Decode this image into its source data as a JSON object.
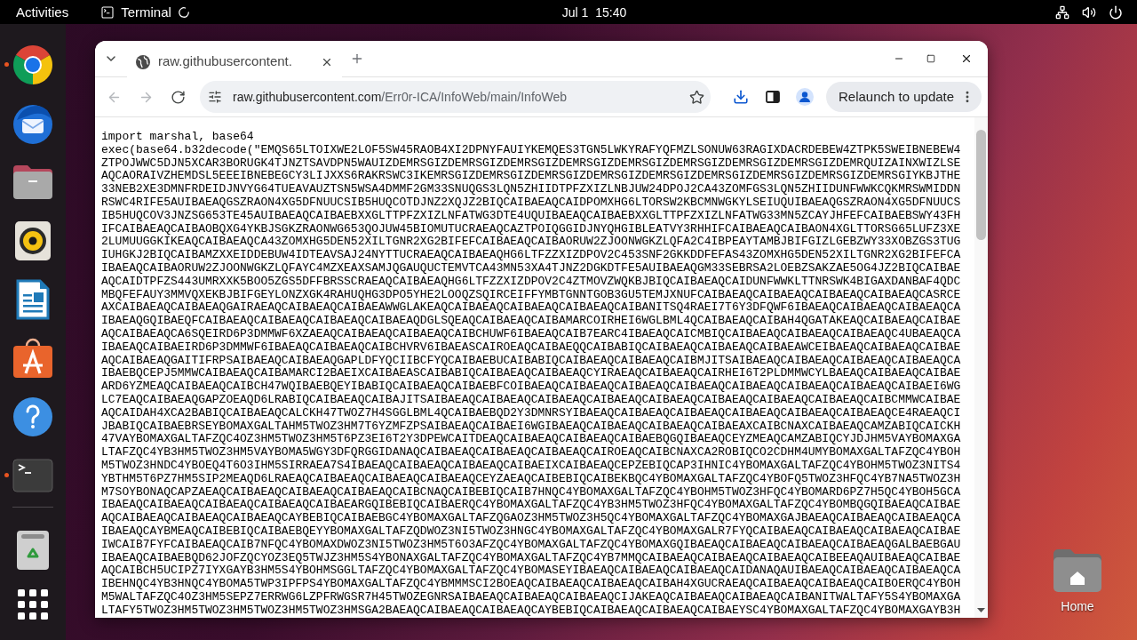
{
  "top_bar": {
    "activities": "Activities",
    "app": {
      "name": "Terminal",
      "loading": true
    },
    "clock": "Jul 1  15:40"
  },
  "dock": {
    "items": [
      {
        "kind": "browser",
        "running": true
      },
      {
        "kind": "mail",
        "running": false
      },
      {
        "kind": "files",
        "running": false
      },
      {
        "kind": "music",
        "running": false
      },
      {
        "kind": "writer",
        "running": false
      },
      {
        "kind": "store",
        "running": false
      },
      {
        "kind": "help",
        "running": false
      },
      {
        "kind": "terminal",
        "running": true
      }
    ],
    "extras": [
      {
        "kind": "trash"
      },
      {
        "kind": "apps"
      }
    ]
  },
  "browser": {
    "tabs": [
      {
        "title": "raw.githubusercontent.",
        "selected": true
      }
    ],
    "nav": [
      {
        "kind": "back",
        "disabled": true
      },
      {
        "kind": "forward",
        "disabled": true
      },
      {
        "kind": "reload",
        "disabled": false
      }
    ],
    "address": {
      "host": "raw.githubusercontent.com",
      "path": "/Err0r-ICA/InfoWeb/main/InfoWeb"
    },
    "relaunch": "Relaunch to update",
    "page_lines": [
      "import marshal, base64",
      "exec(base64.b32decode(\"EMQS65LTOIXWE2LOF5SW45RAOB4XI2DPNYFAUIYKEMQES3TGN5LWKYRAFYQFMZLSONUW63RAGIXDACRDEBEW4ZTPK5SWEIBNEBEW4",
      "ZTPOJWWC5DJN5XCAR3BORUGK4TJNZTSAVDPN5WAUIZDEMRSGIZDEMRSGIZDEMRSGIZDEMRSGIZDEMRSGIZDEMRSGIZDEMRSGIZDEMRSGIZDEMRQUIZAINXWIZLSE",
      "AQCAORAIVZHEMDSL5EEEIBNEBEGCY3LIJXXS6RAKRSWC3IKEMRSGIZDEMRSGIZDEMRSGIZDEMRSGIZDEMRSGIZDEMRSGIZDEMRSGIZDEMRSGIZDEMRSGIYKBJTHE",
      "33NEB2XE3DMNFRDEIDJNVYG64TUEAVAUZTSN5WSA4DMMF2GM33SNUQGS3LQN5ZHIIDTPFZXIZLNBJUW24DPOJ2CA43ZOMFGS3LQN5ZHIIDUNFWWKCQKMRSWMIDDN",
      "RSWC4RIFE5AUIBAEAQGSZRAON4XG5DFNUUCSIB5HUQCOTDJNZ2XQJZ2BIQCAIBAEAQCAIDPOMXHG6LTORSW2KBCMNWGKYLSEIUQUIBAEAQGSZRAON4XG5DFNUUCS",
      "IB5HUQCOV3JNZSG653TE45AUIBAEAQCAIBAEBXXGLTTPFZXIZLNFATWG3DTE4UQUIBAEAQCAIBAEBXXGLTTPFZXIZLNFATWG33MN5ZCAYJHFEFCAIBAEBSWY43FH",
      "IFCAIBAEAQCAIBAOBQXG4YKBJSGKZRAONWG653QOJUW45BIOMUTUCRAEAQCAZTPOIQGGIDJNYQHGIBLEATVY3RHHIFCAIBAEAQCAIBAON4XGLTTORSG65LUFZ3XE",
      "2LUMUUGGKIKEAQCAIBAEAQCA43ZOMXHG5DEN52XILTGNR2XG2BIFEFCAIBAEAQCAIBAORUW2ZJOONWGKZLQFA2C4IBPEAYTAMBJBIFGIZLGEBZWY33XOBZGS3TUG",
      "IUHGKJ2BIQCAIBAMZXXEIDDEBUW4IDTEAVSAJ24NYTTUCRAEAQCAIBAEAQHG6LTFZZXIZDPOV2C453SNF2GKKDDFEFAS43ZOMXHG5DEN52XILTGNR2XG2BIFEFCA",
      "IBAEAQCAIBAORUW2ZJOONWGKZLQFAYC4MZXEAXSAMJQGAUQUCTEMVTCA43MN53XA4TJNZ2DGKDTFE5AUIBAEAQGM33SEBRSA2LOEBZSAKZAE5OG4JZ2BIQCAIBAE",
      "AQCAIDTPFZS443UMRXXK5BOO5ZGS5DFFBRSSCRAEAQCAIBAEAQHG6LTFZZXIZDPOV2C4ZTMOVZWQKBJBIQCAIBAEAQCAIDUNFWWKLTTNRSWK4BIGAXDANBAF4QDC",
      "MBQFEFAUY3MMVQXEKBJBIFGEYLONZXGK4RAHUQHG3DPO5YHE2LOOQZSQIRCEIFFYMBTGNNTGOB3GU5TEMJXNUFCAIBAEAQCAIBAEAQCAIBAEAQCAIBAEAQCASRCE",
      "AXCAIBAEAQCAIBAEAQGAIRAEAQCAIBAEAQCAIBAEAWWGLAKEAQCAIBAEAQCAIBAEAQCAIBAEAQCAIBANITSQ4RAEI7T6Y3DFQWF6IBAEAQCAIBAEAQCAIBAEAQCA",
      "IBAEAQGQIBAEQFCAIBAEAQCAIBAEAQCAIBAEAQCAIBAEAQDGLSQEAQCAIBAEAQCAIBAMARCOIRHEI6WGLBML4QCAIBAEAQCAIBAH4QGATAKEAQCAIBAEAQCAIBAE",
      "AQCAIBAEAQCA6SQEIRD6P3DMMWF6XZAEAQCAIBAEAQCAIBAEAQCAIBCHUWF6IBAEAQCAIB7EARC4IBAEAQCAICMBIQCAIBAEAQCAIBAEAQCAIBAEAQC4UBAEAQCA",
      "IBAEAQCAIBAEIRD6P3DMMWF6IBAEAQCAIBAEAQCAIBCHVRV6IBAEASCAIROEAQCAIBAEQQCAIBABIQCAIBAEAQCAIBAEAQCAIBAEAWCEIBAEAQCAIBAEAQCAIBAE",
      "AQCAIBAEAQGAITIFRPSAIBAEAQCAIBAEAQGAPLDFYQCIIBCFYQCAIBAEBUCAIBABIQCAIBAEAQCAIBAEAQCAIBMJITSAIBAEAQCAIBAEAQCAIBAEAQCAIBAEAQCA",
      "IBAEBQCEPJ5MMWCAIBAEAQCAIBAMARCI2BAEIXCAIBAEASCAIBABIQCAIBAEAQCAIBAEAQCYIRAEAQCAIBAEAQCAIRHEI6T2PLDMMWCYLBAEAQCAIBAEAQCAIBAE",
      "ARD6YZMEAQCAIBAEAQCAIBCH47WQIBAEBQEYIBABIQCAIBAEAQCAIBAEBFCOIBAEAQCAIBAEAQCAIBAEAQCAIBAEAQCAIBAEAQCAIBAEAQCAIBAEAQCAIBAEI6WG",
      "LC7EAQCAIBAEAQGAPZOEAQD6LRABIQCAIBAEAQCAIBAJITSAIBAEAQCAIBAEAQCAIBAEAQCAIBAEAQCAIBAEAQCAIBAEAQCAIBAEAQCAIBAEAQCAIBCMMWCAIBAE",
      "AQCAIDAH4XCA2BABIQCAIBAEAQCALCKH47TWOZ7H4SGGLBML4QCAIBAEBQD2Y3DMNRSYIBAEAQCAIBAEAQCAIBAEAQCAIBAEAQCAIBAEAQCAIBAEAQCE4RAEAQCI",
      "JBABIQCAIBAEBRSEYBOMAXGALTAHM5TWOZ3HM7T6YZMFZPSAIBAEAQCAIBAEI6WGIBAEAQCAIBAEAQCAIBAEAQCAIBAEAXCAIBCNAXCAIBAEAQCAMZABIQCAICKH",
      "47VAYBOMAXGALTAFZQC4OZ3HM5TWOZ3HM5T6PZ3EI6T2Y3DPEWCAITDEAQCAIBAEAQCAIBAEAQCAIBAEBQGQIBAEAQCEYZMEAQCAMZABIQCYJDJHM5VAYBOMAXGA",
      "LTAFZQC4YB3HM5TWOZ3HM5VAYBOMA5WGY3DFQRGGIDANAQCAIBAEAQCAIBAEAQCAIBAEAQCAIROEAQCAIBCNAXCA2ROBIQCO2CDHM4UMYBOMAXGALTAFZQC4YBOH",
      "M5TWOZ3HNDC4YBOEQ4T6O3IHM5SIRRAEA7S4IBAEAQCAIBAEAQCAIBAEAQCAIBAEIXCAIBAEAQCEPZEBIQCAP3IHNIC4YBOMAXGALTAFZQC4YBOHM5TWOZ3NITS4",
      "YBTHM5T6PZ7HM5SIP2MEAQD6LRAEAQCAIBAEAQCAIBAEAQCAIBAEAQCEYZAEAQCAIBEBIQCAIBEKBQC4YBOMAXGALTAFZQC4YBOFQ5TWOZ3HFQC4YB7NA5TWOZ3H",
      "M7SOYBONAQCAPZAEAQCAIBAEAQCAIBAEAQCAIBAEAQCAIBCNAQCAIBEBIQCAIB7HNQC4YBOMAXGALTAFZQC4YBOHM5TWOZ3HFQC4YBOMARD6PZ7H5QC4YBOH5GCA",
      "IBAEAQCAIBAEAQCAIBAEAQCAIBAEAQCAIBAEARGQIBEBIQCAIBAERQC4YBOMAXGALTAFZQC4YB3HM5TWOZ3HFQC4YBOMAXGALTAFZQC4YBOMBQGQIBAEAQCAIBAE",
      "AQCAIBAEAQCAIBAEAQCAIBAEAQCAYBEBIQCAIBAEBGC4YBOMAXGALTAFZQGAOZ3HM5TWOZ3H5QC4YBOMAXGALTAFZQC4YBOMAXGAJBAEAQCAIBAEAQCAIBAEAQCA",
      "IBAEAQCAYBMEAQCAIBEBIQCAIBAEBQEYYBOMAXGALTAFZQDWOZ3NI5TWOZ3HNGC4YBOMAXGALTAFZQC4YBOMAXGALR7FYQCAIBAEAQCAIBAEAQCAIBAEAQCAIBAE",
      "IWCAIB7FYFCAIBAEAQCAIB7NFQC4YBOMAXDWOZ3NI5TWOZ3HM5T6O3AFZQC4YBOMAXGALTAFZQC4YBOMAXGQIBAEAQCAIBAEAQCAIBAEAQCAIBAEAQGALBAEBGAU",
      "IBAEAQCAIBAEBQD62JOFZQCYOZ3EQ5TWJZ3HM5S4YBONAXGALTAFZQC4YBOMAXGALTAFZQC4YB7MMQCAIBAEAQCAIBAEAQCAIBAEAQCAIBEEAQAUIBAEAQCAIBAE",
      "AQCAIBCH5UCIPZ7IYXGAYB3HM5S4YBOHMSGGLTAFZQC4YBOMAXGALTAFZQC4YBOMASEYIBAEAQCAIBAEAQCAIBAEAQCAIDANAQAUIBAEAQCAIBAEAQCAIBAEAQCA",
      "IBEHNQC4YB3HNQC4YBOMA5TWP3IPFPS4YBOMAXGALTAFZQC4YBMMMSCI2BOEAQCAIBAEAQCAIBAEAQCAIBAH4XGUCRAEAQCAIBAEAQCAIBAEAQCAIBOERQC4YBOH",
      "M5WALTAFZQC4OZ3HM5SEPZ7ERRWG6LZPFRWGSR7H45TWOZEGNRSAIBAEAQCAIBAEAQCAIBAEAQCIJAKEAQCAIBAEAQCAIBAEAQCAIBANITWALTAFY5S4YBOMAXGA",
      "LTAFY5TWOZ3HM5TWOZ3HM5TWOZ3HM5TWOZ3HMSGA2BAEAQCAIBAEAQCAIBAEAQCAYBEBIQCAIBAEAQCAIBAEAQCAIBAEYSC4YBOMAXGALTAFZQC4YBOMAXGAYB3H"
    ]
  },
  "desktop": {
    "icons": [
      {
        "label": "Home"
      }
    ]
  }
}
